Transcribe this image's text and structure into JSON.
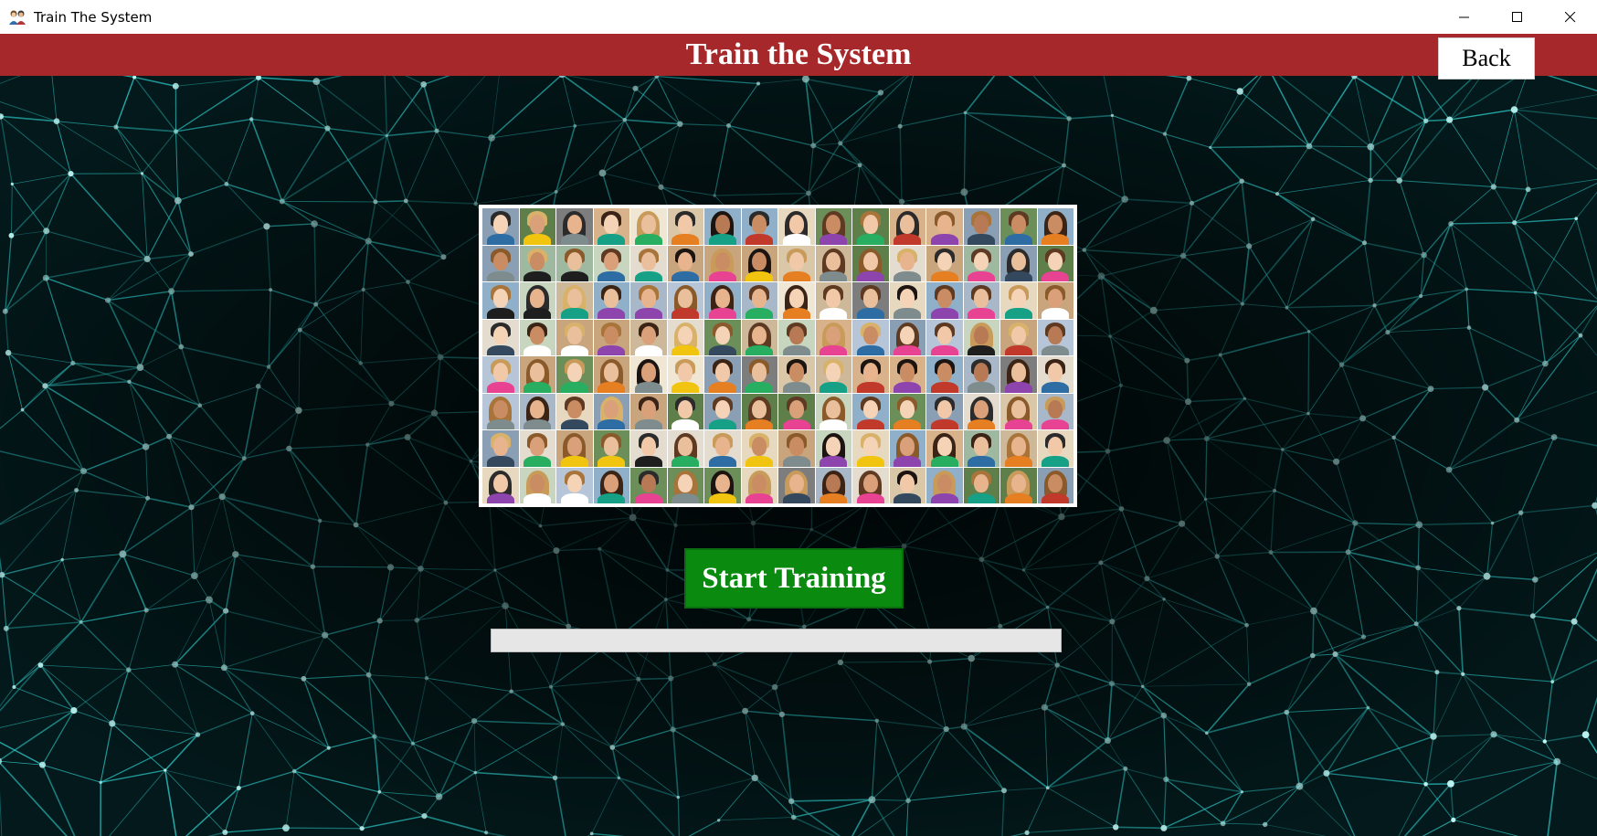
{
  "window": {
    "title": "Train The System",
    "app_icon": "people-icon",
    "controls": [
      "minimize-icon",
      "maximize-icon",
      "close-icon"
    ]
  },
  "header": {
    "title": "Train the System",
    "background_color": "#a6282a",
    "back_label": "Back"
  },
  "main": {
    "collage_image": "faces-collage",
    "start_button_label": "Start Training",
    "start_button_color": "#0a8a0f",
    "progress": {
      "value_percent": 0
    }
  },
  "theme": {
    "background": "#020607",
    "network_color": "#2ec8c8"
  }
}
